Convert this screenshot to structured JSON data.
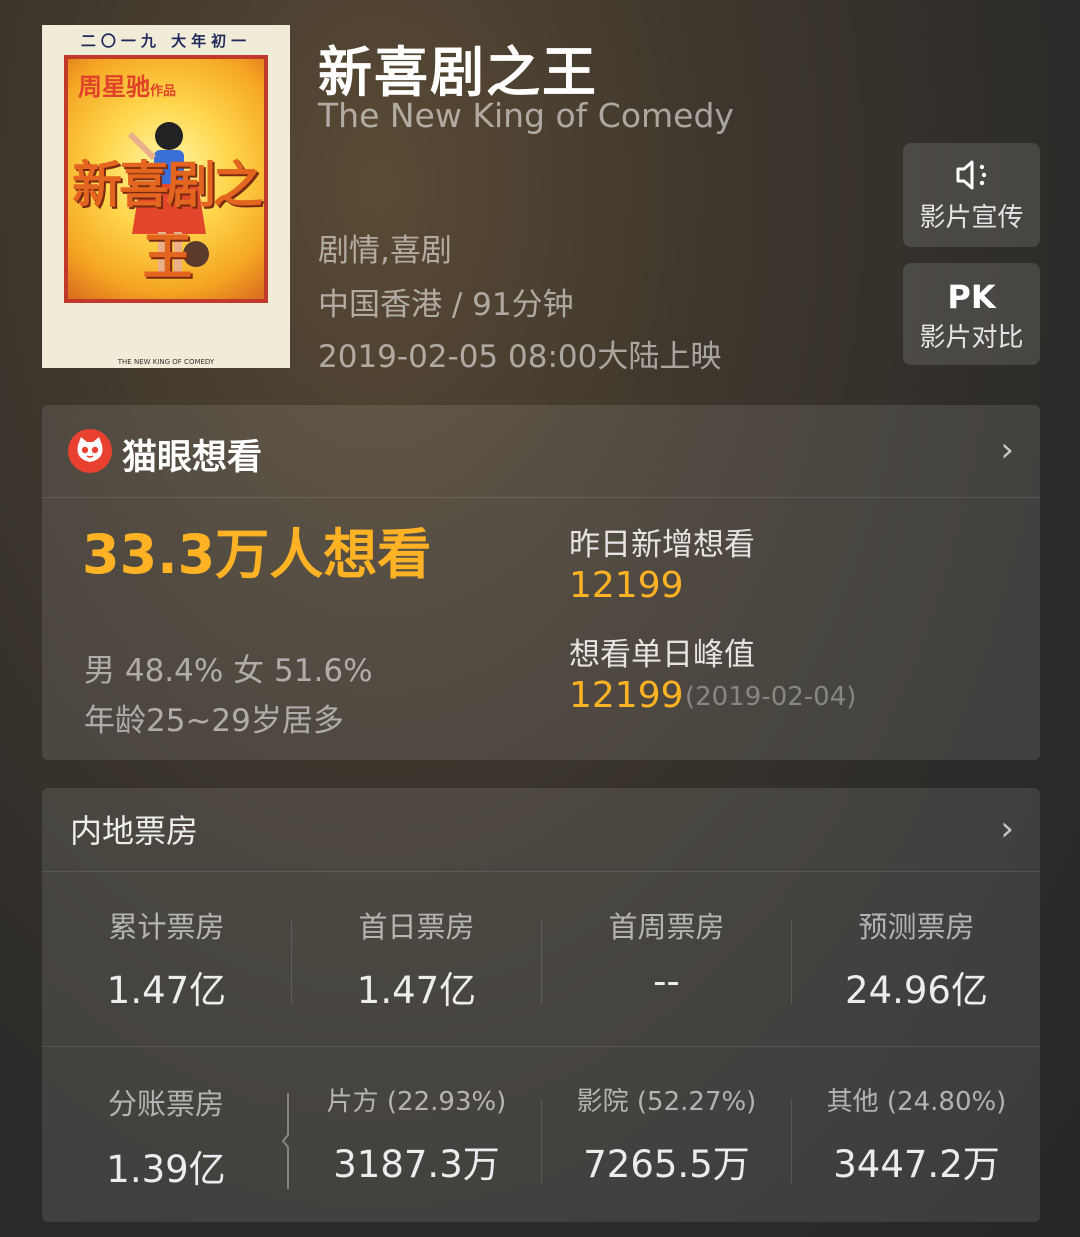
{
  "movie": {
    "title_cn": "新喜剧之王",
    "title_en": "The New King of Comedy",
    "genre": "剧情,喜剧",
    "region_duration": "中国香港 / 91分钟",
    "release": "2019-02-05 08:00大陆上映"
  },
  "poster": {
    "top_text": "二〇一九 大年初一",
    "author": "周星驰",
    "author_suffix": "作品",
    "title": "新喜剧之王",
    "subtitle": "THE NEW KING OF COMEDY"
  },
  "actions": {
    "promo": {
      "icon": "speaker-icon",
      "label": "影片宣传"
    },
    "pk": {
      "icon_text": "PK",
      "label": "影片对比"
    }
  },
  "wish": {
    "brand": "猫眼想看",
    "count": "33.3万人想看",
    "gender": "男 48.4%  女 51.6%",
    "age": "年龄25~29岁居多",
    "yesterday_label": "昨日新增想看",
    "yesterday_value": "12199",
    "peak_label": "想看单日峰值",
    "peak_value": "12199",
    "peak_date": "(2019-02-04)"
  },
  "box_office": {
    "title": "内地票房",
    "stats": [
      {
        "label": "累计票房",
        "value": "1.47亿"
      },
      {
        "label": "首日票房",
        "value": "1.47亿"
      },
      {
        "label": "首周票房",
        "value": "--"
      },
      {
        "label": "预测票房",
        "value": "24.96亿"
      }
    ],
    "split": {
      "label": "分账票房",
      "value": "1.39亿",
      "parts": [
        {
          "label": "片方 (22.93%)",
          "value": "3187.3万"
        },
        {
          "label": "影院 (52.27%)",
          "value": "7265.5万"
        },
        {
          "label": "其他 (24.80%)",
          "value": "3447.2万"
        }
      ]
    }
  },
  "colors": {
    "accent": "#ffb324",
    "brand_red": "#e8412f"
  }
}
